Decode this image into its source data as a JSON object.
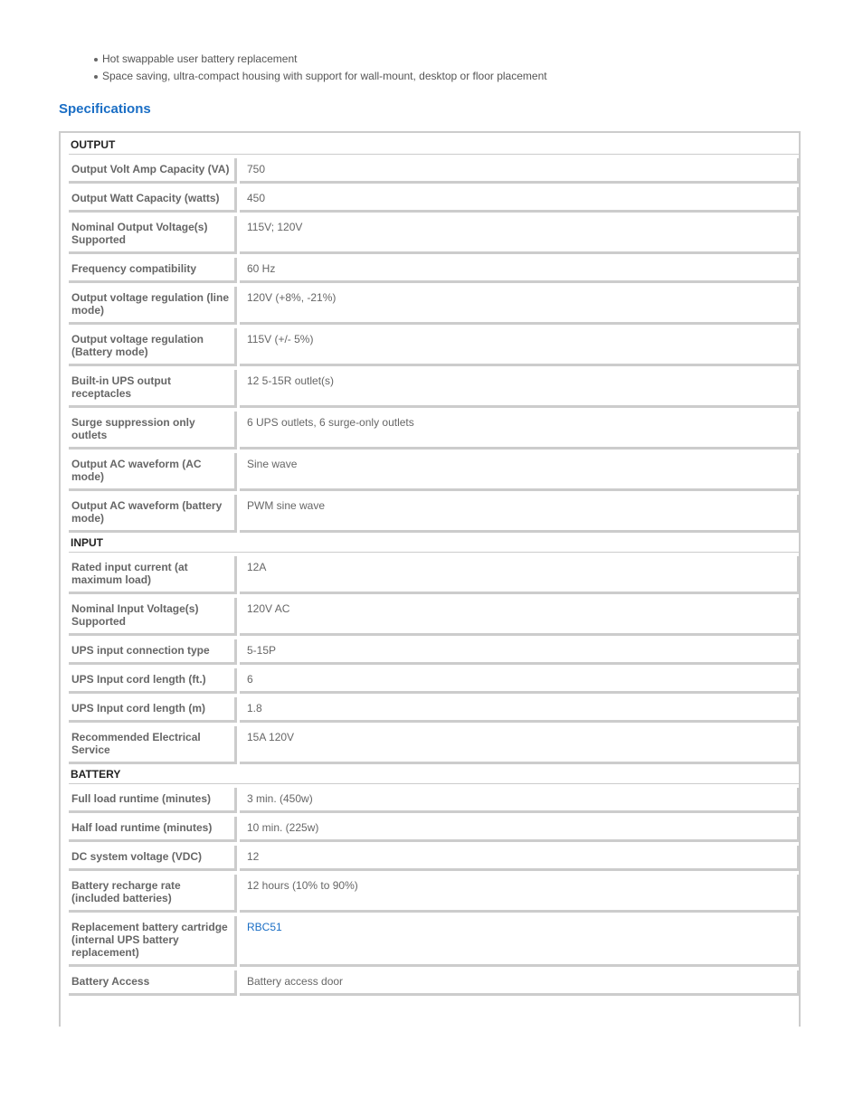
{
  "features": [
    "Hot swappable user battery replacement",
    "Space saving, ultra-compact housing with support for wall-mount, desktop or floor placement"
  ],
  "section_title": "Specifications",
  "colors": {
    "accent": "#1a6ec5",
    "border": "#cccccc",
    "label_text": "#666666"
  },
  "groups": [
    {
      "name": "OUTPUT",
      "rows": [
        {
          "label": "Output Volt Amp Capacity (VA)",
          "value": "750"
        },
        {
          "label": "Output Watt Capacity (watts)",
          "value": "450"
        },
        {
          "label": "Nominal Output Voltage(s) Supported",
          "value": "115V; 120V"
        },
        {
          "label": "Frequency compatibility",
          "value": "60 Hz"
        },
        {
          "label": "Output voltage regulation (line mode)",
          "value": "120V (+8%, -21%)"
        },
        {
          "label": "Output voltage regulation (Battery mode)",
          "value": "115V (+/- 5%)"
        },
        {
          "label": "Built-in UPS output receptacles",
          "value": "12 5-15R outlet(s)"
        },
        {
          "label": "Surge suppression only outlets",
          "value": "6 UPS outlets, 6 surge-only outlets"
        },
        {
          "label": "Output AC waveform (AC mode)",
          "value": "Sine wave"
        },
        {
          "label": "Output AC waveform (battery mode)",
          "value": "PWM sine wave"
        }
      ]
    },
    {
      "name": "INPUT",
      "rows": [
        {
          "label": "Rated input current (at maximum load)",
          "value": "12A"
        },
        {
          "label": "Nominal Input Voltage(s) Supported",
          "value": "120V AC"
        },
        {
          "label": "UPS input connection type",
          "value": "5-15P"
        },
        {
          "label": "UPS Input cord length (ft.)",
          "value": "6"
        },
        {
          "label": "UPS Input cord length (m)",
          "value": "1.8"
        },
        {
          "label": "Recommended Electrical Service",
          "value": "15A 120V"
        }
      ]
    },
    {
      "name": "BATTERY",
      "rows": [
        {
          "label": "Full load runtime (minutes)",
          "value": "3 min. (450w)"
        },
        {
          "label": "Half load runtime (minutes)",
          "value": "10 min. (225w)"
        },
        {
          "label": "DC system voltage (VDC)",
          "value": "12"
        },
        {
          "label": "Battery recharge rate (included batteries)",
          "value": "12 hours (10% to 90%)"
        },
        {
          "label": "Replacement battery cartridge (internal UPS battery replacement)",
          "value": "RBC51",
          "link": true
        },
        {
          "label": "Battery Access",
          "value": "Battery access door"
        }
      ]
    }
  ]
}
